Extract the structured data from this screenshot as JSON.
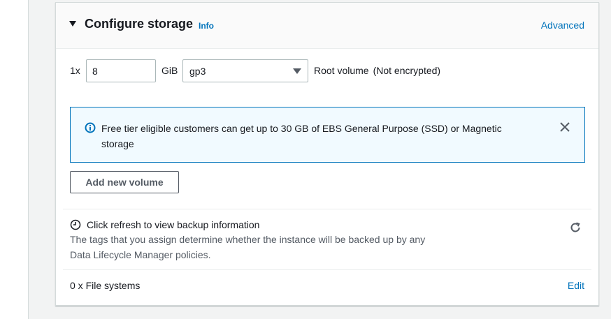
{
  "panel": {
    "title": "Configure storage",
    "info_link": "Info",
    "advanced_link": "Advanced"
  },
  "volume": {
    "prefix": "1x",
    "size_value": "8",
    "unit": "GiB",
    "type_selected": "gp3",
    "label": "Root volume",
    "encryption": "(Not encrypted)"
  },
  "alert": {
    "message": "Free tier eligible customers can get up to 30 GB of EBS General Purpose (SSD) or Magnetic storage",
    "type": "info",
    "color": "#0073bb"
  },
  "add_volume_button": "Add new volume",
  "backup": {
    "title": "Click refresh to view backup information",
    "description": "The tags that you assign determine whether the instance will be backed up by any Data Lifecycle Manager policies."
  },
  "file_systems": {
    "label": "0 x File systems",
    "edit_link": "Edit"
  },
  "colors": {
    "link": "#0073bb",
    "alert_bg": "#f1faff",
    "page_bg": "#f2f3f3"
  },
  "icons": [
    "caret-down-icon",
    "info-circle-icon",
    "close-icon",
    "clock-icon",
    "refresh-icon",
    "chevron-down-icon"
  ]
}
